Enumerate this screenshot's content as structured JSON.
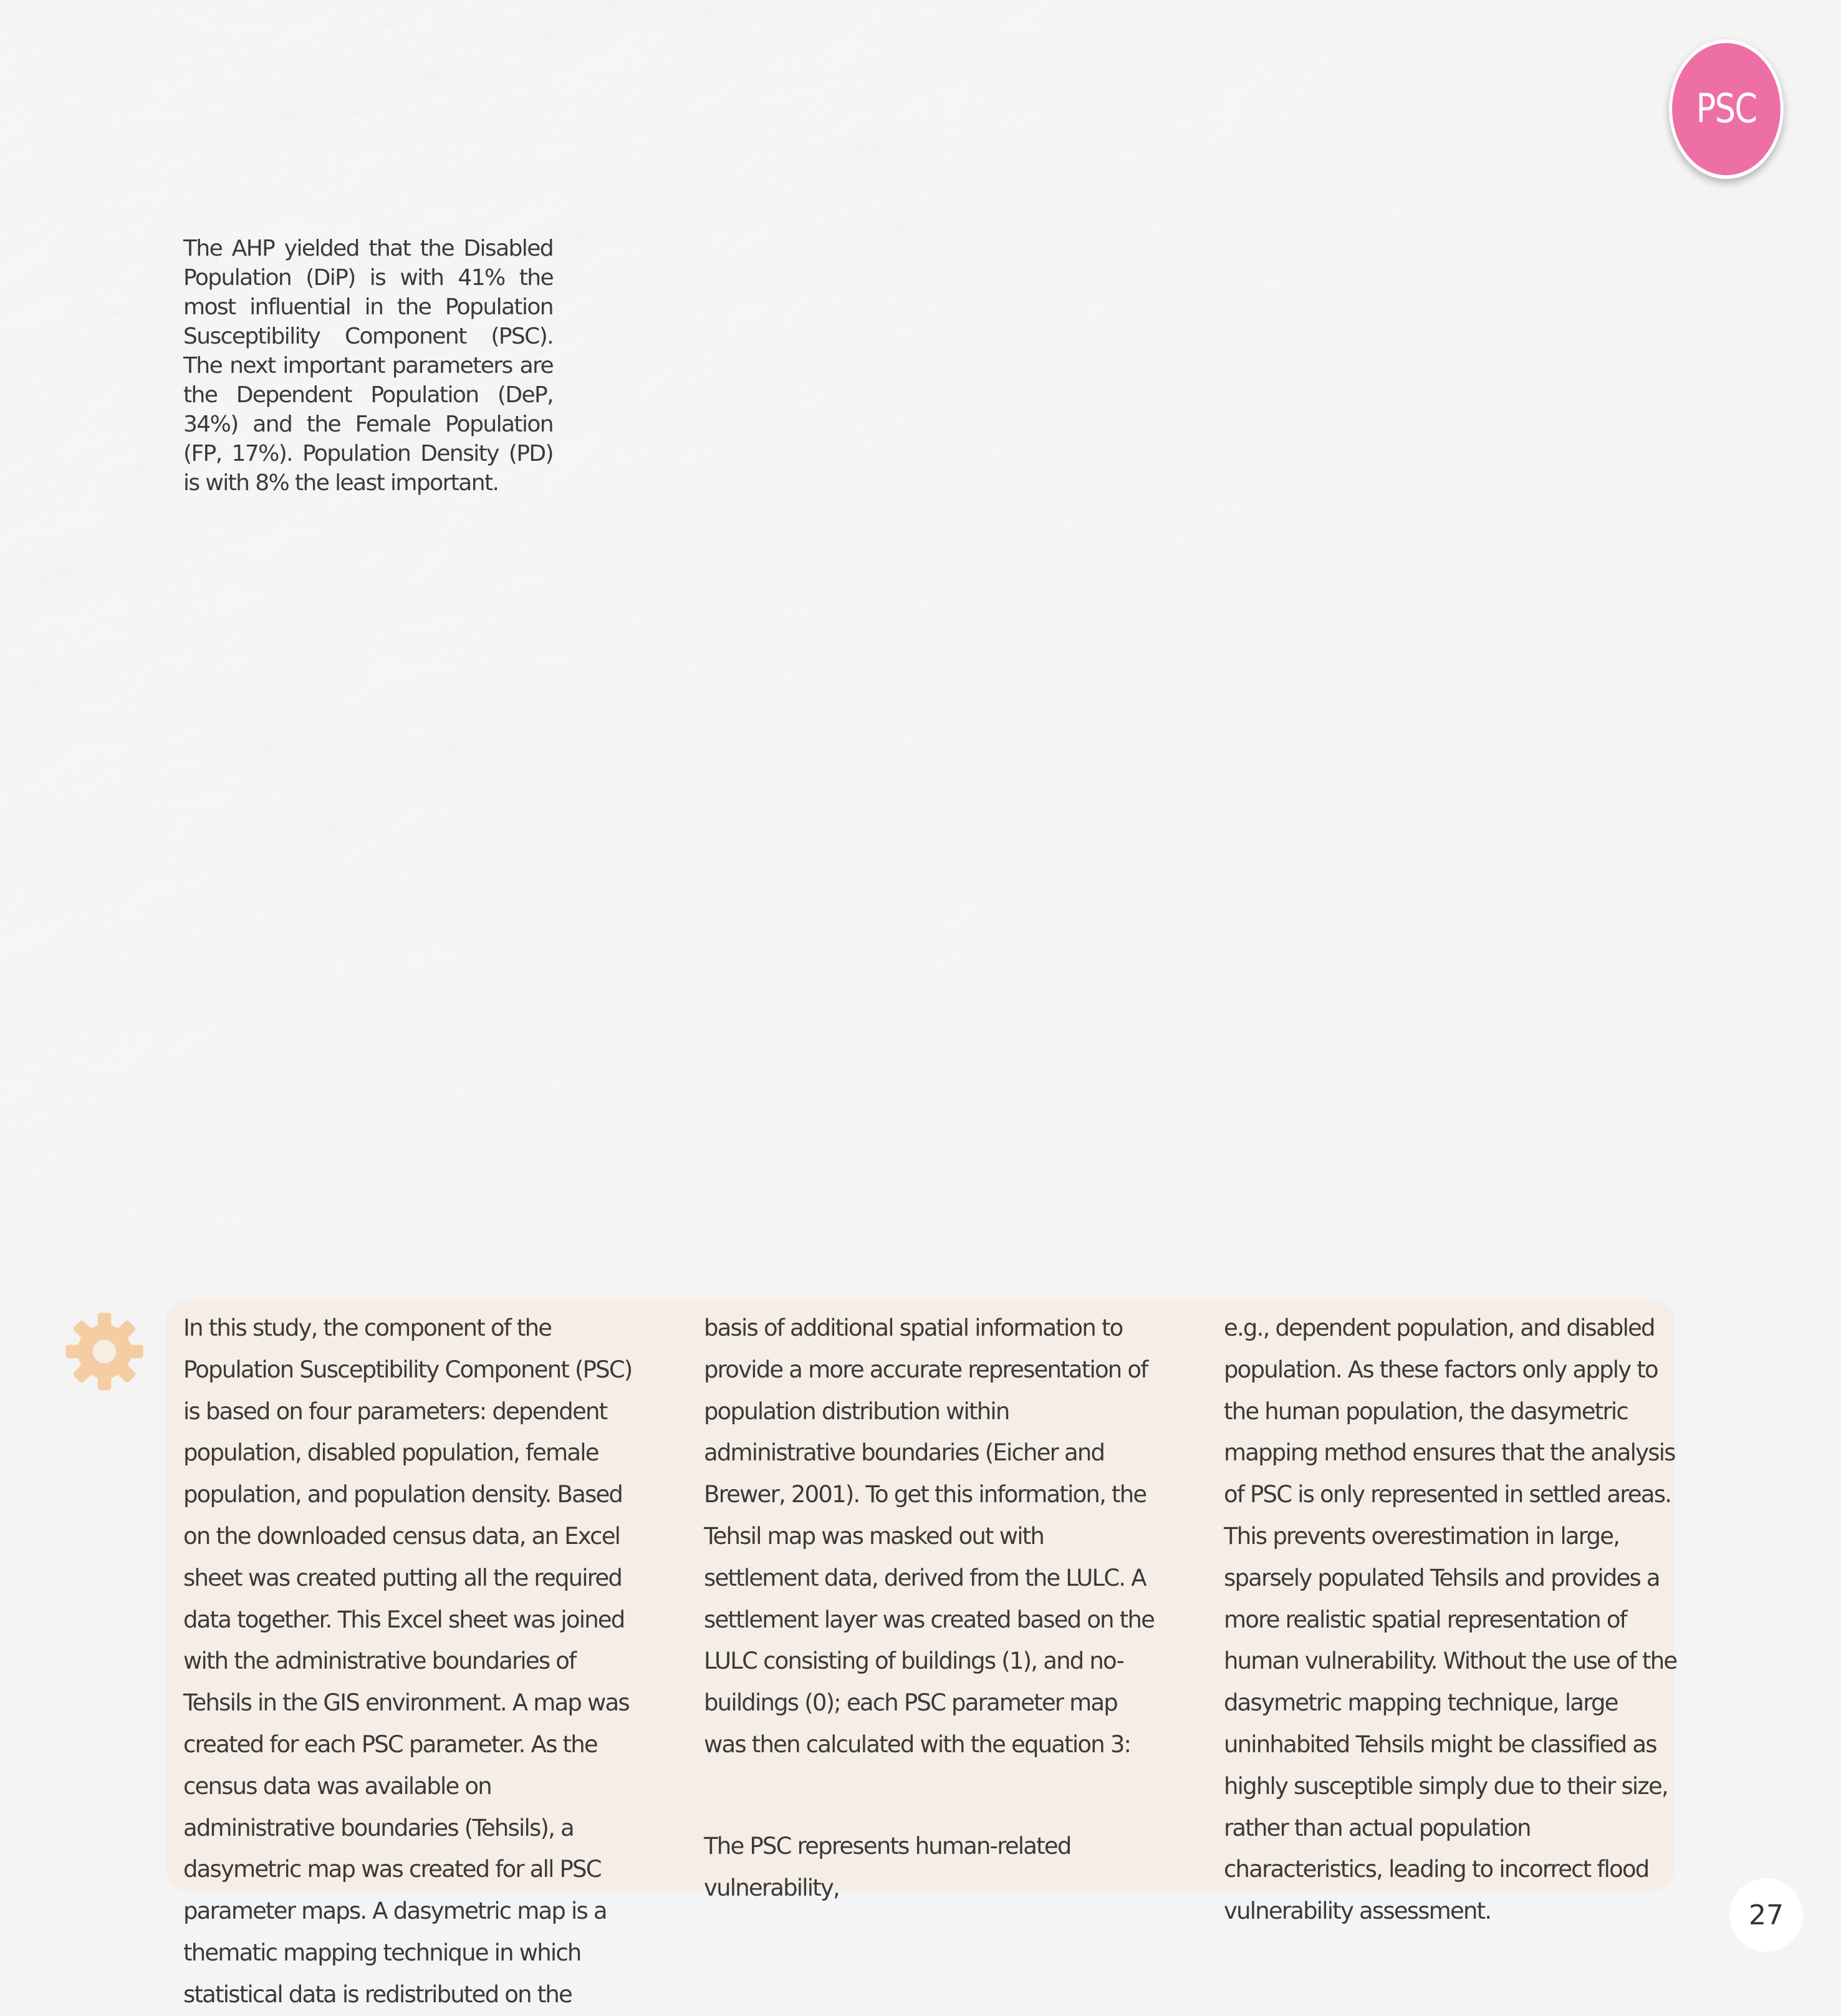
{
  "badge": {
    "label": "PSC",
    "color": "#ee6fa5"
  },
  "intro": {
    "text": "The AHP yielded that the Disabled Population (DiP) is with 41% the most influential in the Population Susceptibility Component (PSC). The next important parameters are the Dependent Population (DeP, 34%) and the Female Population (FP, 17%). Population Density (PD) is with 8% the least important."
  },
  "decoration": {
    "gear_icon": "gear-icon",
    "gear_color": "#f5c796",
    "panel_color": "#f6ede3"
  },
  "body": {
    "col1": "In this study, the component of the Population Susceptibility Component (PSC) is based on four parameters: dependent population, disabled population, female population, and population density. Based on the downloaded census data, an Excel sheet was created putting all the required data together. This Excel sheet was joined with the administrative boundaries of Tehsils in the GIS environment. A map was created for each PSC parameter. As the census data was available on administrative boundaries (Tehsils), a dasymetric map was created for all PSC parameter maps. A dasymetric map is a thematic mapping technique in which statistical data is redistributed on the",
    "col2": "basis of additional spatial information to provide a more accurate representation of population distribution within administrative boundaries (Eicher and Brewer, 2001). To get this information, the Tehsil map was masked out with settlement data, derived from the LULC. A settlement layer was created based on the LULC consisting of buildings (1), and no-buildings (0); each PSC parameter map was then calculated with the equation 3:",
    "col2_tail": "The PSC represents human-related vulnerability,",
    "col3": "e.g., dependent population, and disabled population. As these factors only apply to the human population, the dasymetric mapping method ensures that the analysis of PSC is only represented in settled areas. This prevents overestimation in large, sparsely populated Tehsils and provides a more realistic spatial representation of human vulnerability. Without the use of the dasymetric mapping technique, large uninhabited Tehsils might be classified as highly susceptible simply due to their size, rather than actual population characteristics, leading to incorrect flood vulnerability assessment."
  },
  "footer": {
    "page_number": "27"
  }
}
